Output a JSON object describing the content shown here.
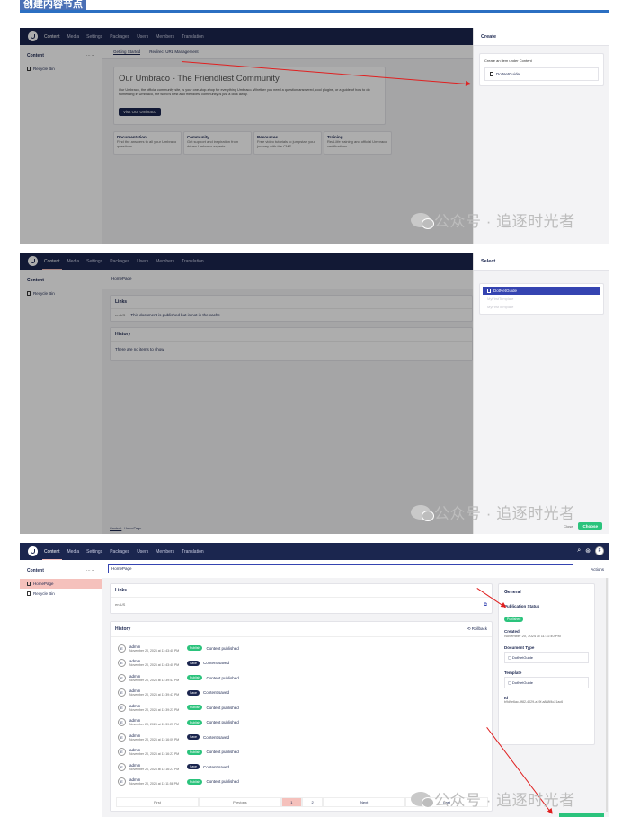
{
  "header": {
    "title": "创建内容节点"
  },
  "nav": [
    "Content",
    "Media",
    "Settings",
    "Packages",
    "Users",
    "Members",
    "Translation"
  ],
  "tree": {
    "title": "Content",
    "actions": "··· +",
    "recycle": "Recycle Bin",
    "homepage": "HomePage"
  },
  "s1": {
    "tabs": [
      "Getting Started",
      "Redirect URL Management"
    ],
    "hero_title": "Our Umbraco - The Friendliest Community",
    "hero_text": "Our Umbraco, the official community site, is your one-stop-shop for everything Umbraco. Whether you need a question answered, cool plugins, or a guide of how to do something in Umbraco, the world's best and friendliest community is just a click away.",
    "hero_button": "Visit Our Umbraco",
    "cards": [
      {
        "title": "Documentation",
        "text": "Find the answers to all your Umbraco questions"
      },
      {
        "title": "Community",
        "text": "Get support and inspiration from driven Umbraco experts"
      },
      {
        "title": "Resources",
        "text": "Free video tutorials to jumpstart your journey with the CMS"
      },
      {
        "title": "Training",
        "text": "Real-life training and official Umbraco certifications"
      }
    ],
    "panel_title": "Create",
    "panel_sub": "Create an item under Content",
    "panel_item": "DotNetGuide"
  },
  "s2": {
    "node": "HomePage",
    "links_title": "Links",
    "links_text": "This document is published but is not in the cache",
    "links_lang": "en-US",
    "history_title": "History",
    "history_empty": "There are no items to show",
    "breadcrumb": "Content",
    "breadcrumb2": "HomePage",
    "panel_title": "Select",
    "items": [
      "DotNetGuide",
      "MyFirstTemplate",
      "MyFirstTemplate"
    ],
    "close": "Close",
    "choose": "Choose"
  },
  "s3": {
    "name_value": "HomePage",
    "actions": "Actions",
    "links_title": "Links",
    "links_lang": "en-US",
    "history_title": "History",
    "rollback": "Rollback",
    "user": "admin",
    "history": [
      {
        "date": "November 20, 2024 at 11:43:40 PM",
        "tag": "Publish",
        "text": "Content published"
      },
      {
        "date": "November 20, 2024 at 11:43:40 PM",
        "tag": "Save",
        "text": "Content saved"
      },
      {
        "date": "November 20, 2024 at 11:39:47 PM",
        "tag": "Publish",
        "text": "Content published"
      },
      {
        "date": "November 20, 2024 at 11:39:47 PM",
        "tag": "Save",
        "text": "Content saved"
      },
      {
        "date": "November 20, 2024 at 11:39:23 PM",
        "tag": "Publish",
        "text": "Content published"
      },
      {
        "date": "November 20, 2024 at 11:39:23 PM",
        "tag": "Publish",
        "text": "Content published"
      },
      {
        "date": "November 20, 2024 at 11:16:09 PM",
        "tag": "Save",
        "text": "Content saved"
      },
      {
        "date": "November 20, 2024 at 11:16:27 PM",
        "tag": "Publish",
        "text": "Content published"
      },
      {
        "date": "November 20, 2024 at 11:16:27 PM",
        "tag": "Save",
        "text": "Content saved"
      },
      {
        "date": "November 20, 2024 at 11:11:56 PM",
        "tag": "Publish",
        "text": "Content published"
      }
    ],
    "pager": [
      "First",
      "Previous",
      "1",
      "2",
      "Next",
      "Last"
    ],
    "general": {
      "title": "General",
      "status_label": "Publication Status",
      "status": "Published",
      "created_label": "Created",
      "created": "November 20, 2024 at 11:11:40 PM",
      "doctype_label": "Document Type",
      "doctype": "DotNetGuide",
      "template_label": "Template",
      "template": "DotNetGuide",
      "id_label": "Id",
      "id": "b9d9e6ac-9f82-4029-a19f-a888f4c21ac6"
    },
    "user_initial": "F"
  },
  "watermark": "公众号 · 追逐时光者"
}
